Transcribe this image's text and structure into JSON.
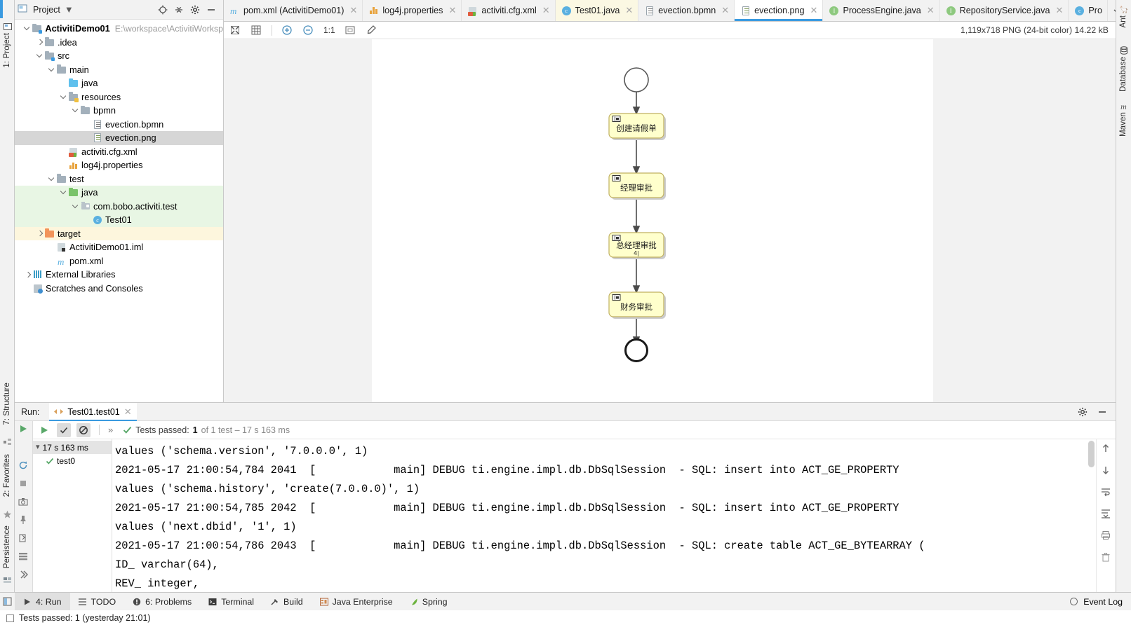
{
  "project_panel": {
    "title": "Project",
    "header_icons": [
      "locate-icon",
      "collapse-all-icon",
      "settings-gear-icon",
      "minimize-icon"
    ],
    "tree": [
      {
        "label": "ActivitiDemo01",
        "sub": "E:\\workspace\\ActivitiWorksp",
        "depth": 0,
        "arrow": "down",
        "icon": "module-folder-icon",
        "bold": true,
        "state": ""
      },
      {
        "label": ".idea",
        "sub": "",
        "depth": 1,
        "arrow": "right",
        "icon": "folder-grey-icon",
        "bold": false,
        "state": ""
      },
      {
        "label": "src",
        "sub": "",
        "depth": 1,
        "arrow": "down",
        "icon": "folder-source-root-icon",
        "bold": false,
        "state": ""
      },
      {
        "label": "main",
        "sub": "",
        "depth": 2,
        "arrow": "down",
        "icon": "folder-grey-icon",
        "bold": false,
        "state": ""
      },
      {
        "label": "java",
        "sub": "",
        "depth": 3,
        "arrow": "none",
        "icon": "folder-blue-source-icon",
        "bold": false,
        "state": ""
      },
      {
        "label": "resources",
        "sub": "",
        "depth": 3,
        "arrow": "down",
        "icon": "folder-resources-icon",
        "bold": false,
        "state": ""
      },
      {
        "label": "bpmn",
        "sub": "",
        "depth": 4,
        "arrow": "down",
        "icon": "folder-grey-icon",
        "bold": false,
        "state": ""
      },
      {
        "label": "evection.bpmn",
        "sub": "",
        "depth": 5,
        "arrow": "none",
        "icon": "file-bpmn-icon",
        "bold": false,
        "state": ""
      },
      {
        "label": "evection.png",
        "sub": "",
        "depth": 5,
        "arrow": "none",
        "icon": "file-image-icon",
        "bold": false,
        "state": "selected"
      },
      {
        "label": "activiti.cfg.xml",
        "sub": "",
        "depth": 3,
        "arrow": "none",
        "icon": "file-spring-xml-icon",
        "bold": false,
        "state": ""
      },
      {
        "label": "log4j.properties",
        "sub": "",
        "depth": 3,
        "arrow": "none",
        "icon": "file-properties-icon",
        "bold": false,
        "state": ""
      },
      {
        "label": "test",
        "sub": "",
        "depth": 2,
        "arrow": "down",
        "icon": "folder-grey-icon",
        "bold": false,
        "state": ""
      },
      {
        "label": "java",
        "sub": "",
        "depth": 3,
        "arrow": "down",
        "icon": "folder-test-source-icon",
        "bold": false,
        "state": "green"
      },
      {
        "label": "com.bobo.activiti.test",
        "sub": "",
        "depth": 4,
        "arrow": "down",
        "icon": "package-icon",
        "bold": false,
        "state": "green"
      },
      {
        "label": "Test01",
        "sub": "",
        "depth": 5,
        "arrow": "none",
        "icon": "java-test-class-icon",
        "bold": false,
        "state": "green"
      },
      {
        "label": "target",
        "sub": "",
        "depth": 1,
        "arrow": "right",
        "icon": "folder-excluded-icon",
        "bold": false,
        "state": "yellow"
      },
      {
        "label": "ActivitiDemo01.iml",
        "sub": "",
        "depth": 2,
        "arrow": "none",
        "icon": "file-iml-icon",
        "bold": false,
        "state": ""
      },
      {
        "label": "pom.xml",
        "sub": "",
        "depth": 2,
        "arrow": "none",
        "icon": "file-maven-pom-icon",
        "bold": false,
        "state": ""
      },
      {
        "label": "External Libraries",
        "sub": "",
        "depth": 0,
        "arrow": "right",
        "icon": "external-libraries-icon",
        "bold": false,
        "state": ""
      },
      {
        "label": "Scratches and Consoles",
        "sub": "",
        "depth": 0,
        "arrow": "none",
        "icon": "scratches-icon",
        "bold": false,
        "state": ""
      }
    ]
  },
  "editor_tabs": [
    {
      "label": "pom.xml (ActivitiDemo01)",
      "icon": "maven-pom-icon",
      "state": ""
    },
    {
      "label": "log4j.properties",
      "icon": "properties-icon",
      "state": ""
    },
    {
      "label": "activiti.cfg.xml",
      "icon": "spring-xml-icon",
      "state": ""
    },
    {
      "label": "Test01.java",
      "icon": "java-test-class-icon",
      "state": "modified"
    },
    {
      "label": "evection.bpmn",
      "icon": "bpmn-file-icon",
      "state": ""
    },
    {
      "label": "evection.png",
      "icon": "image-file-icon",
      "state": "active"
    },
    {
      "label": "ProcessEngine.java",
      "icon": "java-interface-icon",
      "state": ""
    },
    {
      "label": "RepositoryService.java",
      "icon": "java-interface-icon",
      "state": ""
    },
    {
      "label": "Pro",
      "icon": "java-class-icon",
      "state": "truncated"
    }
  ],
  "image_toolbar": {
    "buttons": [
      "toggle-transparency-icon",
      "toggle-grid-icon",
      "zoom-in-icon",
      "zoom-out-icon",
      "actual-size-icon",
      "fit-to-window-icon",
      "color-picker-icon"
    ],
    "actual_size_label": "1:1",
    "image_info": "1,119x718 PNG (24-bit color) 14.22 kB"
  },
  "bpmn_diagram": {
    "nodes": [
      {
        "type": "start-event",
        "label": ""
      },
      {
        "type": "user-task",
        "label": "创建请假单"
      },
      {
        "type": "user-task",
        "label": "经理审批"
      },
      {
        "type": "user-task",
        "label": "总经理审批",
        "label2": "4|"
      },
      {
        "type": "user-task",
        "label": "财务审批"
      },
      {
        "type": "end-event",
        "label": ""
      }
    ],
    "task_fill": "#ffffcc",
    "task_stroke": "#c0b060"
  },
  "run_panel": {
    "label": "Run:",
    "tab_label": "Test01.test01",
    "toolbar": {
      "rerun_icon": "run-green-arrow-icon",
      "show_passed_icon": "check-icon",
      "hide_ignored_icon": "no-entry-icon",
      "expand_icon": "expand-chevrons-icon",
      "status_check": "green-check-icon",
      "status_prefix": "Tests passed:",
      "status_count": "1",
      "status_suffix": "of 1 test – 17 s 163 ms"
    },
    "test_tree": [
      {
        "label": "17 s 163 ms",
        "icon": "duration-chevron-icon",
        "selected": true
      },
      {
        "label": "test0",
        "icon": "green-check-icon",
        "selected": false
      }
    ],
    "console_lines": [
      "values ('schema.version', '7.0.0.0', 1)",
      "2021-05-17 21:00:54,784 2041  [            main] DEBUG ti.engine.impl.db.DbSqlSession  - SQL: insert into ACT_GE_PROPERTY",
      "values ('schema.history', 'create(7.0.0.0)', 1)",
      "2021-05-17 21:00:54,785 2042  [            main] DEBUG ti.engine.impl.db.DbSqlSession  - SQL: insert into ACT_GE_PROPERTY",
      "values ('next.dbid', '1', 1)",
      "2021-05-17 21:00:54,786 2043  [            main] DEBUG ti.engine.impl.db.DbSqlSession  - SQL: create table ACT_GE_BYTEARRAY (",
      "ID_ varchar(64),",
      "REV_ integer,"
    ],
    "right_gutter_icons": [
      "scroll-up-icon",
      "scroll-down-icon",
      "soft-wrap-icon",
      "scroll-to-end-icon",
      "print-icon",
      "trash-icon"
    ],
    "left_gutter_icons": [
      "run-icon",
      "rerun-icon",
      "stop-icon",
      "screenshot-icon",
      "pin-icon",
      "export-icon",
      "settings-icon",
      "help-icon"
    ]
  },
  "bottom_bar": {
    "items": [
      {
        "label": "4: Run",
        "underline": "4",
        "icon": "run-arrow-icon",
        "active": true
      },
      {
        "label": "TODO",
        "underline": "",
        "icon": "todo-list-icon",
        "active": false
      },
      {
        "label": "6: Problems",
        "underline": "6",
        "icon": "problems-icon",
        "active": false
      },
      {
        "label": "Terminal",
        "underline": "",
        "icon": "terminal-icon",
        "active": false
      },
      {
        "label": "Build",
        "underline": "",
        "icon": "build-hammer-icon",
        "active": false
      },
      {
        "label": "Java Enterprise",
        "underline": "",
        "icon": "java-enterprise-icon",
        "active": false
      },
      {
        "label": "Spring",
        "underline": "",
        "icon": "spring-leaf-icon",
        "active": false
      }
    ],
    "event_log": "Event Log"
  },
  "status_bar": {
    "text": "Tests passed: 1 (yesterday 21:01)"
  },
  "left_strip": [
    {
      "label": "1: Project",
      "icon": "project-icon",
      "selected": true
    },
    {
      "label": "7: Structure",
      "icon": "structure-icon",
      "selected": false
    },
    {
      "label": "2: Favorites",
      "icon": "favorites-star-icon",
      "selected": false
    },
    {
      "label": "Persistence",
      "icon": "persistence-icon",
      "selected": false
    }
  ],
  "right_strip": [
    {
      "label": "Ant",
      "icon": "ant-icon"
    },
    {
      "label": "Database",
      "icon": "database-icon"
    },
    {
      "label": "Maven",
      "icon": "maven-m-icon"
    }
  ]
}
